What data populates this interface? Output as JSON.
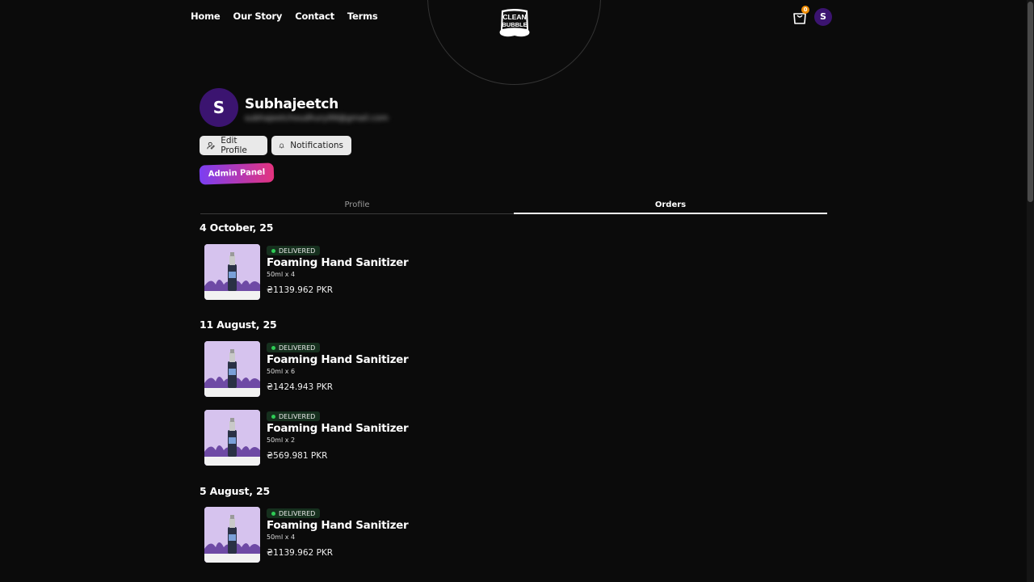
{
  "nav": {
    "items": [
      {
        "label": "Home"
      },
      {
        "label": "Our Story"
      },
      {
        "label": "Contact"
      },
      {
        "label": "Terms"
      }
    ]
  },
  "brand": {
    "line1": "CLEAN",
    "line2": "BUBBLE"
  },
  "cart": {
    "count": "0",
    "icon": "shopping-bag-icon",
    "badge_color": "#f08c00"
  },
  "user": {
    "initial": "S",
    "avatar_color": "#3b1470"
  },
  "profile": {
    "initial": "S",
    "name": "Subhajeetch",
    "email": "subhajeetchoudhury99@gmail.com",
    "edit_label": "Edit Profile",
    "notifications_label": "Notifications",
    "admin_label": "Admin Panel"
  },
  "tabs": [
    {
      "label": "Profile",
      "active": false
    },
    {
      "label": "Orders",
      "active": true
    }
  ],
  "orders": [
    {
      "date": "4 October, 25",
      "items": [
        {
          "status": "DELIVERED",
          "name": "Foaming Hand Sanitizer",
          "qty": "50ml x 4",
          "price": "₴1139.962 PKR"
        }
      ]
    },
    {
      "date": "11 August, 25",
      "items": [
        {
          "status": "DELIVERED",
          "name": "Foaming Hand Sanitizer",
          "qty": "50ml x 6",
          "price": "₴1424.943 PKR"
        },
        {
          "status": "DELIVERED",
          "name": "Foaming Hand Sanitizer",
          "qty": "50ml x 2",
          "price": "₴569.981 PKR"
        }
      ]
    },
    {
      "date": "5 August, 25",
      "items": [
        {
          "status": "DELIVERED",
          "name": "Foaming Hand Sanitizer",
          "qty": "50ml x 4",
          "price": "₴1139.962 PKR"
        }
      ]
    }
  ],
  "colors": {
    "accent_gradient_start": "#7b3ff2",
    "accent_gradient_end": "#e4337e",
    "delivered": "#2ecc55",
    "background": "#0b0b0b"
  }
}
